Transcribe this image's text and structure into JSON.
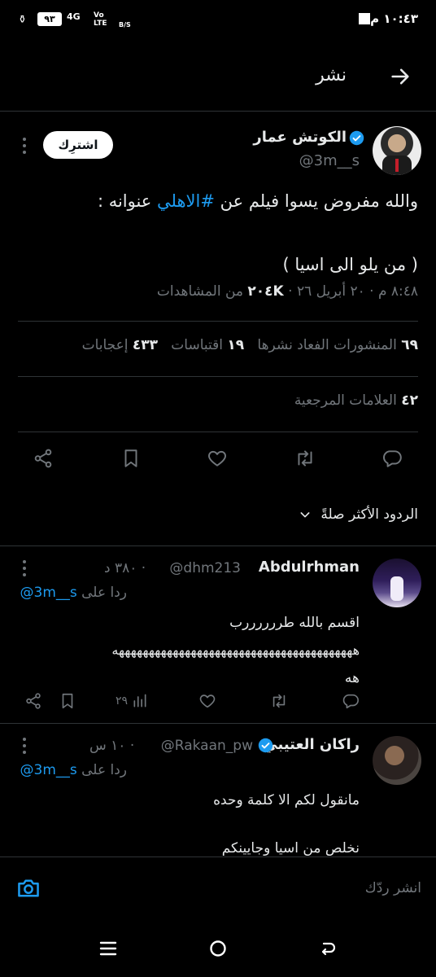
{
  "status_bar": {
    "time": "١٠:٤٣ م",
    "battery": "٩٣",
    "network": "4G",
    "volte": "Vo LTE",
    "speed": "B/S"
  },
  "header": {
    "title": "نشر"
  },
  "tweet": {
    "author_name": "الكوتش عمار",
    "author_handle": "@3m__s",
    "subscribe_label": "اشترِك",
    "text_before_hashtag": "والله مفروض يسوا فيلم عن ",
    "hashtag": "#الاهلي",
    "text_after_hashtag": " عنوانه :",
    "text_line2": "( من يلو الى اسيا )",
    "timestamp": "٨:٤٨ م · ٢٠ أبريل ٢٦ ·",
    "views_count": "٢٠٤K",
    "views_label": "من المشاهدات",
    "reposts_count": "٦٩",
    "reposts_label": "المنشورات الفعاد نشرها",
    "quotes_count": "١٩",
    "quotes_label": "اقتباسات",
    "likes_count": "٤٣٣",
    "likes_label": "إعجابات",
    "bookmarks_count": "٤٢",
    "bookmarks_label": "العلامات المرجعية"
  },
  "replies_sort": {
    "label": "الردود الأكثر صلةً"
  },
  "replies": [
    {
      "name": "Abdulrhman",
      "handle": "@dhm213",
      "time": "· ٣٨٠ د",
      "reply_to_prefix": "ردا على",
      "reply_to_handle": "@3m__s",
      "line1": "اقسم بالله طررررررب",
      "line2": "ههههههههههههههههههههههههههههههههههههههههه",
      "line3": "هه",
      "views": "٢٩"
    },
    {
      "name": "راكان العتيبي",
      "handle": "@Rakaan_pw",
      "time": "· ١٠ س",
      "reply_to_prefix": "ردا على",
      "reply_to_handle": "@3m__s",
      "line1": "مانقول لكم الا كلمة وحده",
      "line2": "نخلص من اسيا وجايينكم"
    }
  ],
  "compose": {
    "placeholder": "انشر ردّك"
  },
  "colors": {
    "accent": "#1d9bf0",
    "background": "#000000",
    "muted": "#71767b",
    "divider": "#2f3336"
  }
}
